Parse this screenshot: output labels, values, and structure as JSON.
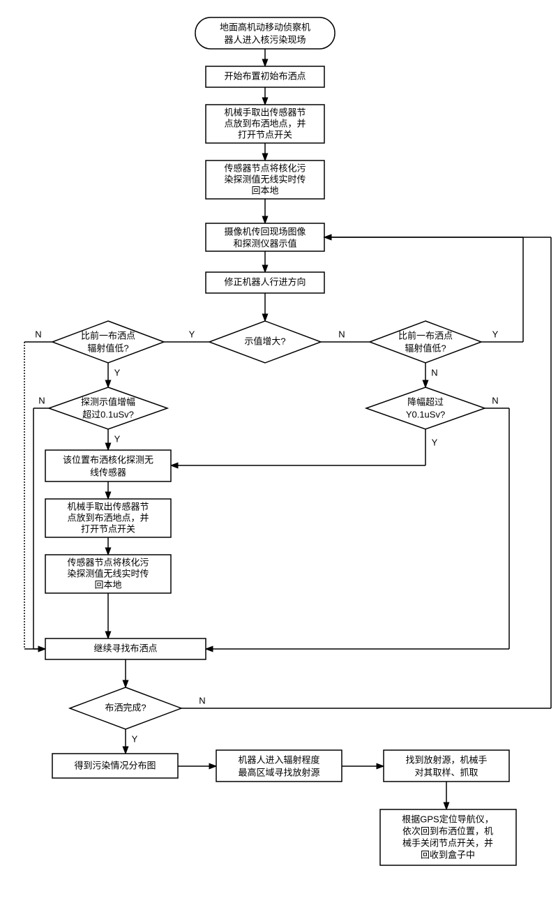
{
  "flowchart": {
    "start1": "地面高机动移动侦察机",
    "start2": "器人进入核污染现场",
    "b1": "开始布置初始布洒点",
    "b2_1": "机械手取出传感器节",
    "b2_2": "点放到布洒地点，并",
    "b2_3": "打开节点开关",
    "b3_1": "传感器节点将核化污",
    "b3_2": "染探测值无线实时传",
    "b3_3": "回本地",
    "b4_1": "摄像机传回现场图像",
    "b4_2": "和探测仪器示值",
    "b5": "修正机器人行进方向",
    "d1": "示值增大?",
    "d2_1": "比前一布洒点",
    "d2_2": "辐射值低?",
    "d3_1": "比前一布洒点",
    "d3_2": "辐射值低?",
    "d4_1": "探测示值增幅",
    "d4_2": "超过0.1uSv?",
    "d5_1": "降幅超过",
    "d5_2": "Y0.1uSv?",
    "b6_1": "该位置布洒核化探测无",
    "b6_2": "线传感器",
    "b7_1": "机械手取出传感器节",
    "b7_2": "点放到布洒地点，并",
    "b7_3": "打开节点开关",
    "b8_1": "传感器节点将核化污",
    "b8_2": "染探测值无线实时传",
    "b8_3": "回本地",
    "b9": "继续寻找布洒点",
    "d6": "布洒完成?",
    "b10": "得到污染情况分布图",
    "b11_1": "机器人进入辐射程度",
    "b11_2": "最高区域寻找放射源",
    "b12_1": "找到放射源，机械手",
    "b12_2": "对其取样、抓取",
    "b13_1": "根据GPS定位导航仪，",
    "b13_2": "依次回到布洒位置，机",
    "b13_3": "械手关闭节点开关，并",
    "b13_4": "回收到盒子中",
    "Y": "Y",
    "N": "N"
  }
}
